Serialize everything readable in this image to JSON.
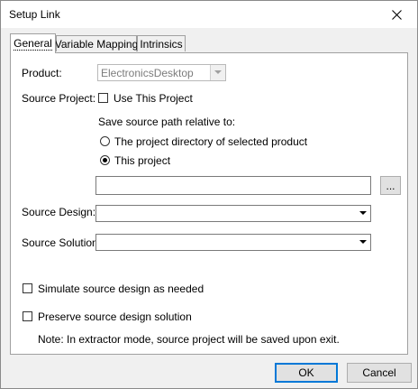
{
  "window": {
    "title": "Setup Link"
  },
  "tabs": [
    {
      "label": "General",
      "active": true
    },
    {
      "label": "Variable Mapping",
      "active": false
    },
    {
      "label": "Intrinsics",
      "active": false
    }
  ],
  "general": {
    "product": {
      "label": "Product:",
      "value": "ElectronicsDesktop",
      "enabled": false
    },
    "source_project": {
      "label": "Source Project:",
      "use_this_project_label": "Use This Project",
      "use_this_project_checked": false
    },
    "save_path": {
      "label": "Save source path relative to:",
      "options": [
        {
          "label": "The project directory of selected product",
          "checked": false
        },
        {
          "label": "This project",
          "checked": true
        }
      ],
      "path_value": "",
      "browse_label": "..."
    },
    "source_design": {
      "label": "Source Design:",
      "value": ""
    },
    "source_solution": {
      "label": "Source Solution:",
      "value": ""
    },
    "simulate": {
      "label": "Simulate source design as needed",
      "checked": false
    },
    "preserve": {
      "label": "Preserve source design solution",
      "checked": false
    },
    "note": "Note: In extractor mode, source project will be saved upon exit."
  },
  "buttons": {
    "ok": "OK",
    "cancel": "Cancel"
  },
  "icons": {
    "close": "close-icon",
    "dropdown": "chevron-down-icon"
  },
  "colors": {
    "accent": "#0078d7",
    "window_bg": "#f0f0f0",
    "panel_bg": "#ffffff"
  }
}
